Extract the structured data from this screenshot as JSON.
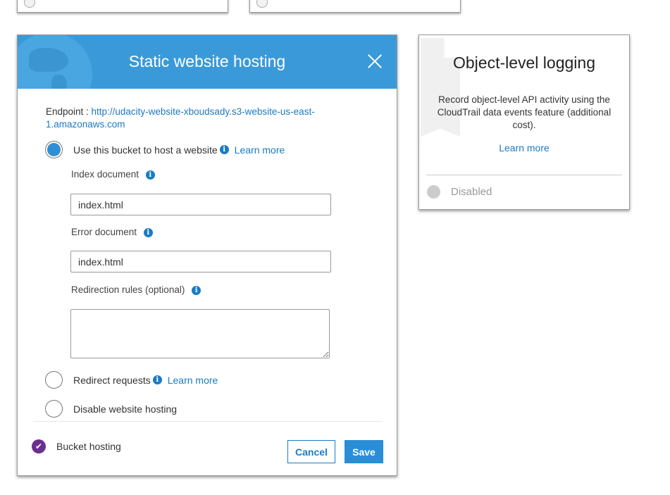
{
  "modal": {
    "title": "Static website hosting",
    "endpoint_label": "Endpoint : ",
    "endpoint_url": "http://udacity-website-xboudsady.s3-website-us-east-1.amazonaws.com",
    "options": [
      {
        "label": "Use this bucket to host a website",
        "learn_more": "Learn more",
        "selected": true
      },
      {
        "label": "Redirect requests",
        "learn_more": "Learn more",
        "selected": false
      },
      {
        "label": "Disable website hosting",
        "selected": false
      }
    ],
    "index_document": {
      "label": "Index document",
      "value": "index.html"
    },
    "error_document": {
      "label": "Error document",
      "value": "index.html"
    },
    "redirection_rules": {
      "label": "Redirection rules (optional)",
      "value": ""
    },
    "footer": {
      "status_label": "Bucket hosting",
      "cancel_label": "Cancel",
      "save_label": "Save"
    }
  },
  "logging_card": {
    "title": "Object-level logging",
    "description": "Record object-level API activity using the CloudTrail data events feature (additional cost).",
    "learn_more": "Learn more",
    "status": "Disabled"
  },
  "colors": {
    "header_blue": "#3a9ad9",
    "link_blue": "#1a7bc3",
    "check_purple": "#6b2f8f",
    "disabled_gray": "#999999"
  }
}
